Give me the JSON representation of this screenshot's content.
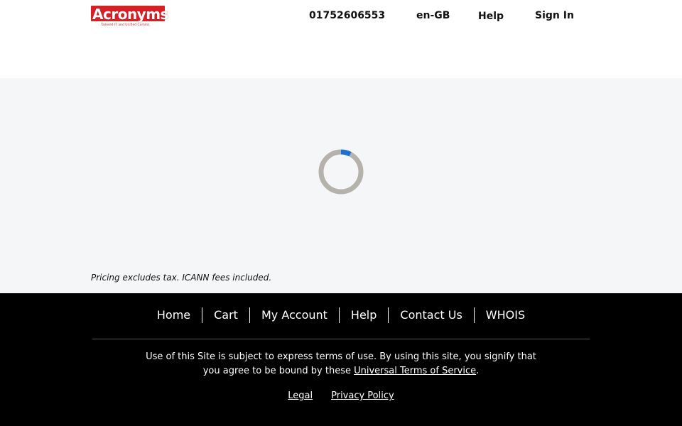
{
  "header": {
    "logo_text": "Acronyms",
    "logo_tagline": "Tailored IT and Unified Comms",
    "phone": "01752606553",
    "language": "en-GB",
    "help_label": "Help",
    "sign_in_label": "Sign In"
  },
  "main": {
    "pricing_note": "Pricing excludes tax. ICANN fees included."
  },
  "footer": {
    "nav": [
      {
        "label": "Home"
      },
      {
        "label": "Cart"
      },
      {
        "label": "My Account"
      },
      {
        "label": "Help"
      },
      {
        "label": "Contact Us"
      },
      {
        "label": "WHOIS"
      }
    ],
    "terms_text_1": "Use of this Site is subject to express terms of use. By using this site, you signify that you agree to be bound by these ",
    "terms_link": "Universal Terms of Service",
    "terms_text_2": ".",
    "legal_label": "Legal",
    "privacy_label": "Privacy Policy"
  },
  "colors": {
    "brand_red": "#d71f26",
    "spinner_track": "#b5b2ab",
    "spinner_accent": "#1f6fd1",
    "main_bg": "#f5f6f7",
    "footer_bg": "#000000"
  },
  "icons": {
    "spinner": "loading-spinner-icon"
  }
}
